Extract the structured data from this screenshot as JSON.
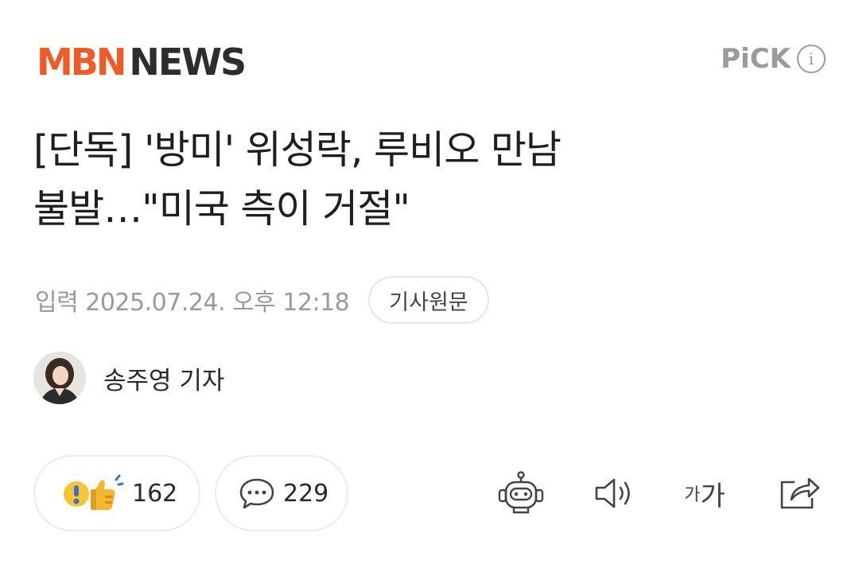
{
  "header": {
    "logo_mbn": "MBN",
    "logo_news": "NEWS",
    "pick_label": "PiCK",
    "info_glyph": "i"
  },
  "article": {
    "title_line1": "[단독] '방미' 위성락, 루비오 만남",
    "title_line2": "불발…\"미국 측이 거절\"",
    "date": "입력 2025.07.24. 오후 12:18",
    "source_label": "기사원문"
  },
  "reporter": {
    "name": "송주영 기자"
  },
  "actions": {
    "reactions_count": "162",
    "comments_count": "229",
    "font_small": "가",
    "font_large": "가"
  },
  "icons": {
    "reaction": "reaction-emoji-icon",
    "comment": "speech-bubble-icon",
    "bot": "robot-icon",
    "audio": "speaker-icon",
    "share": "share-icon"
  },
  "colors": {
    "brand_orange": "#f15a22",
    "brand_dark": "#2d2d2d",
    "muted": "#9a9a9a",
    "icon_dark": "#444444"
  }
}
